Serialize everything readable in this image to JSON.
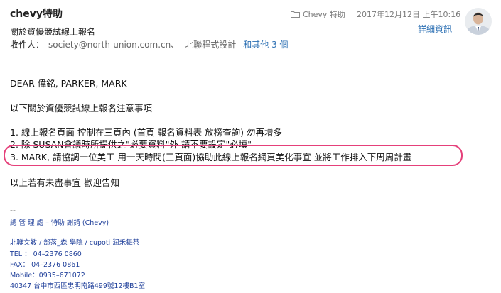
{
  "header": {
    "sender": "chevy特助",
    "subject": "關於資優競試線上報名",
    "to_label": "收件人：",
    "to_address": "society@north-union.com.cn",
    "to_separator": "、",
    "to_second": "北聯程式設計",
    "more_recipients": "和其他 3 個",
    "folder": "Chevy 特助",
    "date": "2017年12月12日 上午10:16",
    "details_link": "詳細資訊",
    "folder_icon": "folder-icon",
    "avatar_icon": "avatar"
  },
  "body": {
    "greeting": "DEAR 偉銘, PARKER, MARK",
    "intro": "以下關於資優競試線上報名注意事項",
    "items": [
      "1. 線上報名頁面 控制在三頁內 (首頁 報名資料表 放榜查詢) 勿再增多",
      "2. 除 SUSAN會議時所提供之\"必要資料\"外 請不要設定\"必填\"",
      "3. MARK, 請協調一位美工 用一天時間(三頁面)協助此線上報名網頁美化事宜 並將工作排入下周周計畫"
    ],
    "closing": "以上若有未盡事宜 歡迎告知"
  },
  "signature": {
    "dashes": "--",
    "title_line": "總 管 理 處 – 特助  謝錡 (Chevy)",
    "org_line": "北聯文教 / 部落_森 學院 / cupoti 润禾舞茶",
    "tel": "TEL ： 04–2376 0860",
    "fax": "FAX： 04–2376 0861",
    "mobile": "Mobile：0935–671072",
    "address_prefix": "40347 ",
    "address": "台中市西區忠明南路499號12樓B1室"
  },
  "colors": {
    "link": "#2b6fb3",
    "highlight": "#e5407a",
    "signature": "#1f3f9a"
  }
}
